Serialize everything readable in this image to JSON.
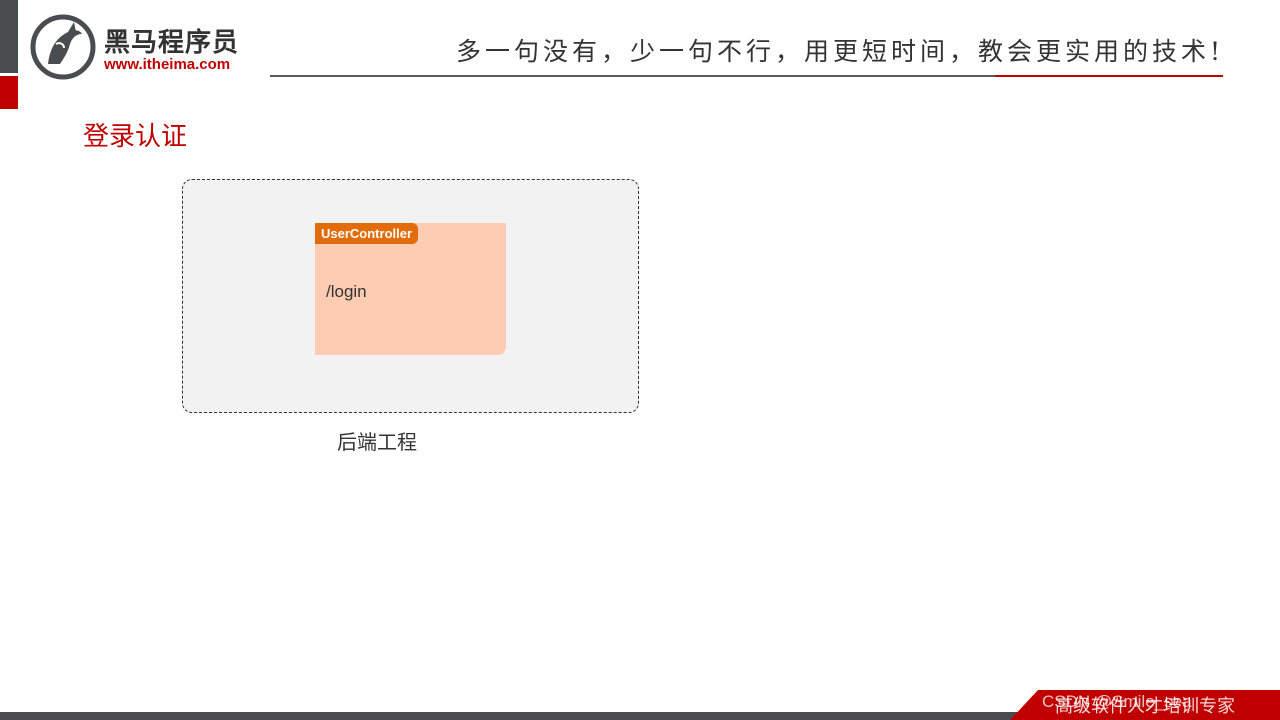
{
  "header": {
    "logo_name": "黑马程序员",
    "logo_url": "www.itheima.com",
    "slogan": "多一句没有，少一句不行，用更短时间，教会更实用的技术!"
  },
  "page": {
    "title": "登录认证"
  },
  "diagram": {
    "controller_name": "UserController",
    "endpoint": "/login",
    "container_label": "后端工程"
  },
  "footer": {
    "text": "高级软件人才培训专家",
    "watermark": "CSDN @Smile_sea"
  },
  "colors": {
    "accent_red": "#c00000",
    "dark_gray": "#4a4d4f",
    "controller_tag": "#e36c0a",
    "controller_card": "#fecbb3",
    "container_bg": "#f2f2f2"
  }
}
